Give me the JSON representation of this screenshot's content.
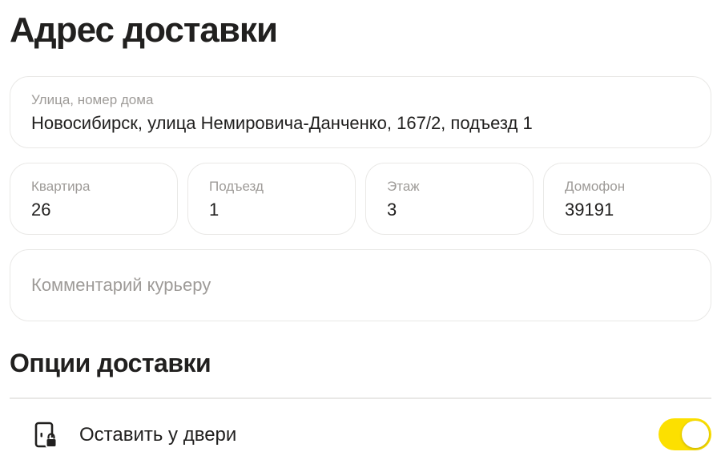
{
  "page_title": "Адрес доставки",
  "address": {
    "street": {
      "label": "Улица, номер дома",
      "value": "Новосибирск, улица Немировича-Данченко, 167/2, подъезд 1"
    },
    "apartment": {
      "label": "Квартира",
      "value": "26"
    },
    "entrance": {
      "label": "Подъезд",
      "value": "1"
    },
    "floor": {
      "label": "Этаж",
      "value": "3"
    },
    "intercom": {
      "label": "Домофон",
      "value": "39191"
    },
    "comment": {
      "placeholder": "Комментарий курьеру",
      "value": ""
    }
  },
  "delivery_options": {
    "title": "Опции доставки",
    "items": [
      {
        "icon": "door-lock-icon",
        "label": "Оставить у двери",
        "enabled": true
      }
    ]
  },
  "colors": {
    "accent": "#fce000",
    "text": "#21201f",
    "muted": "#9e9b98",
    "border": "#e9e8e6"
  }
}
